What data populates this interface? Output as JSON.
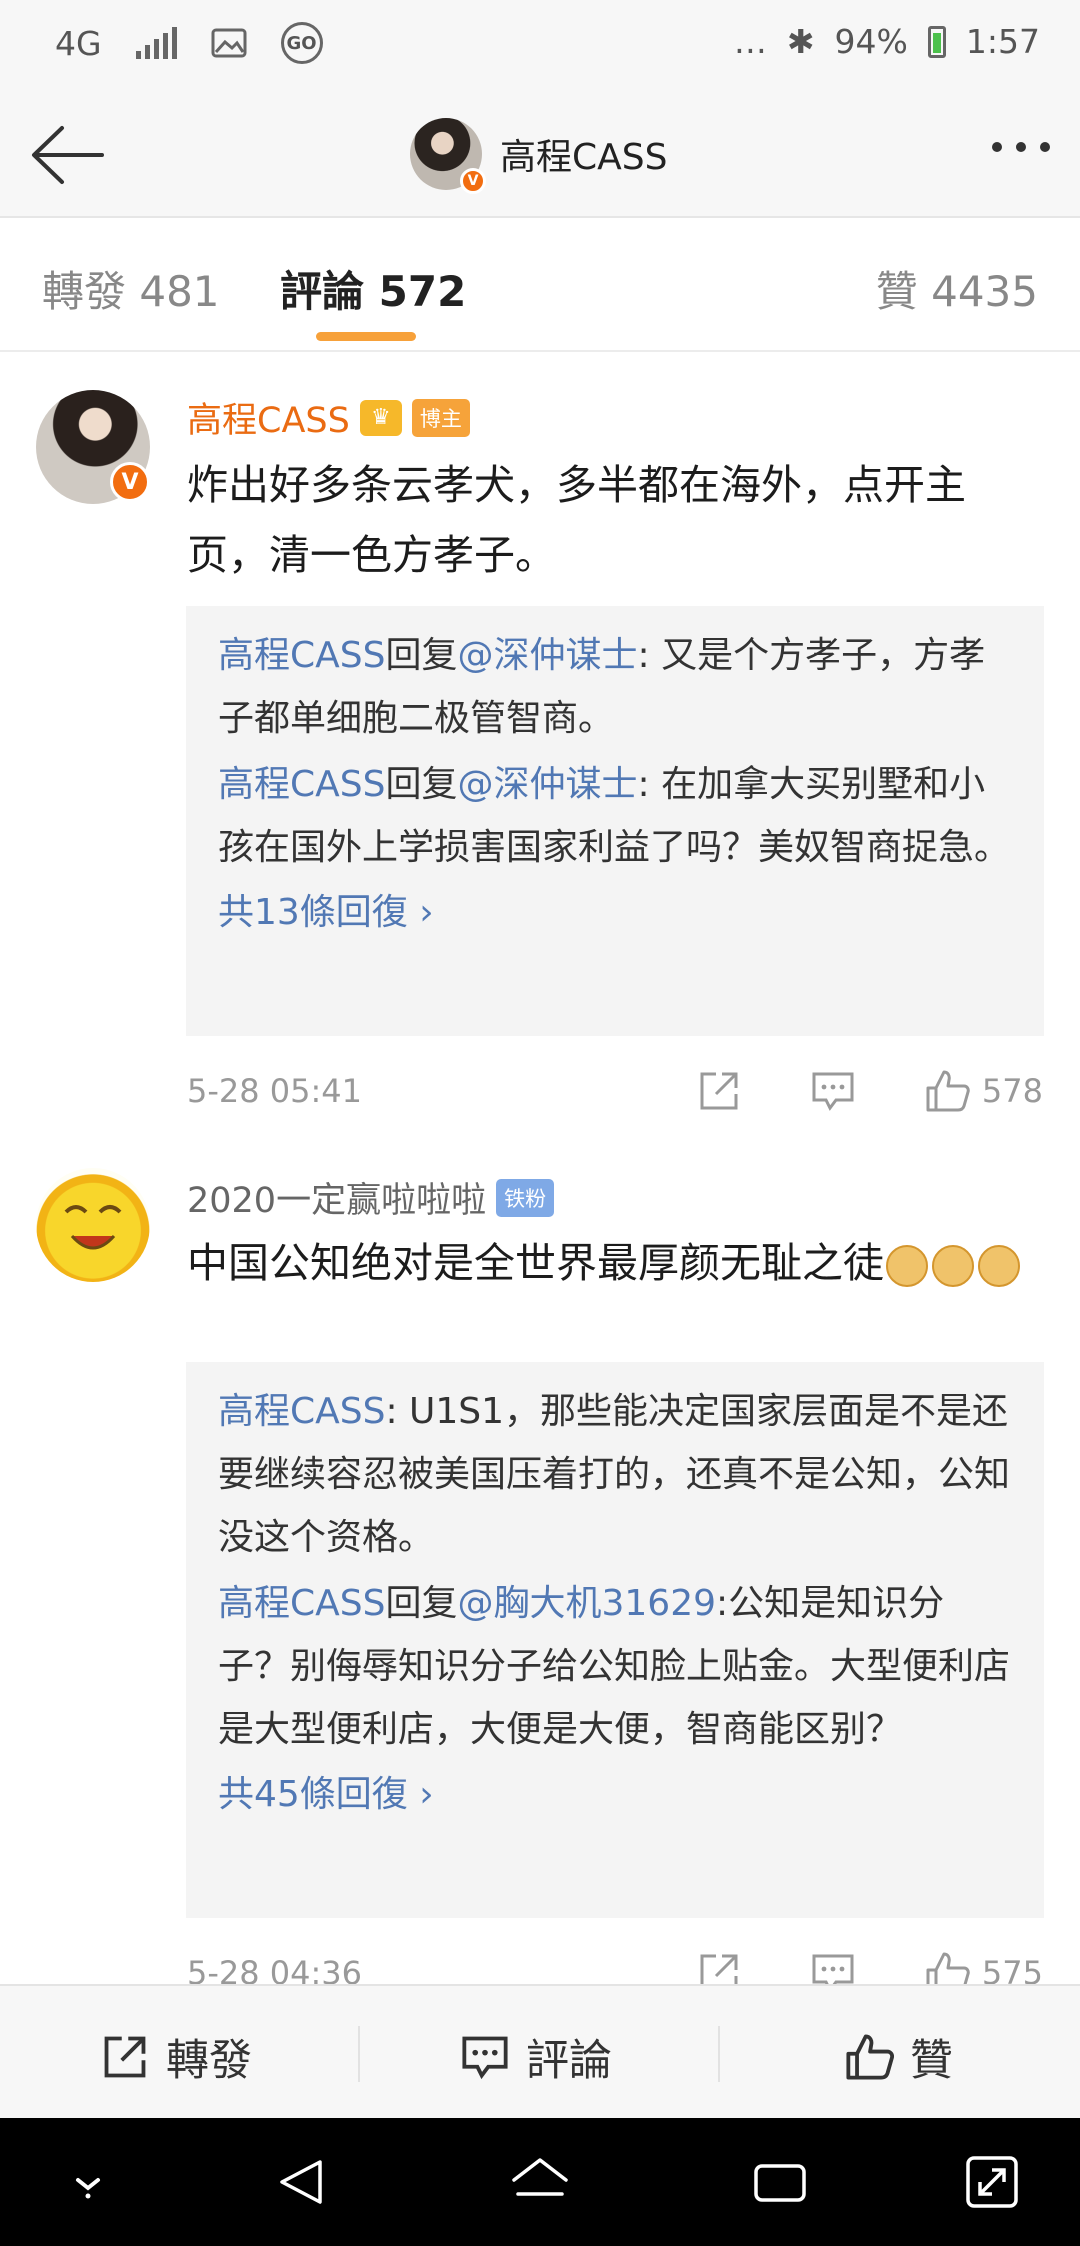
{
  "status_bar": {
    "network": "4G",
    "go_label": "GO",
    "ellipsis": "…",
    "bluetooth": "✱",
    "battery_percent": "94%",
    "time": "1:57"
  },
  "header": {
    "title": "高程CASS",
    "back_icon": "arrow-left-icon",
    "more_icon": "more-dots-icon"
  },
  "tabs": [
    {
      "label": "轉發 481"
    },
    {
      "label": "評論 572",
      "active": true
    },
    {
      "label": "贊 4435"
    }
  ],
  "comments": [
    {
      "username": "高程CASS",
      "badge_text": "博主",
      "verified_mark": "V",
      "crown": "♛",
      "text": "炸出好多条云孝犬，多半都在海外，点开主页，清一色方孝子。",
      "replies": [
        {
          "author": "高程CASS",
          "verb": "回复",
          "target": "@深仲谋士",
          "text": ": 又是个方孝子，方孝子都单细胞二极管智商。"
        },
        {
          "author": "高程CASS",
          "verb": "回复",
          "target": "@深仲谋士",
          "text": ": 在加拿大买别墅和小孩在国外上学损害国家利益了吗？美奴智商捉急。"
        }
      ],
      "more_replies": "共13條回復 ›",
      "time": "5-28 05:41",
      "likes": "578"
    },
    {
      "username": "2020一定赢啦啦啦",
      "badge_text": "铁粉",
      "text": "中国公知绝对是全世界最厚颜无耻之徒",
      "replies": [
        {
          "author": "高程CASS",
          "verb": "",
          "target": "",
          "text": ":  U1S1，那些能决定国家层面是不是还要继续容忍被美国压着打的，还真不是公知，公知没这个资格。"
        },
        {
          "author": "高程CASS",
          "verb": "回复",
          "target": "@胸大机31629",
          "text": ":公知是知识分子？别侮辱知识分子给公知脸上贴金。大型便利店是大型便利店，大便是大便，智商能区别？"
        }
      ],
      "more_replies": "共45條回復 ›",
      "time": "5-28 04:36",
      "likes": "575"
    }
  ],
  "bottom_bar": {
    "repost": "轉發",
    "comment": "評論",
    "like": "贊"
  }
}
